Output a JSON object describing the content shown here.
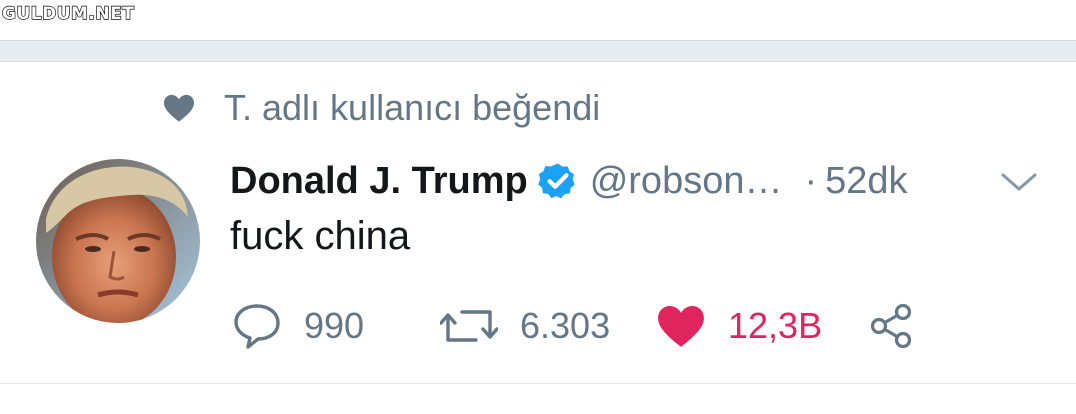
{
  "watermark": "GULDUM.NET",
  "social_context": {
    "text": "T. adlı kullanıcı beğendi",
    "icon": "heart-icon"
  },
  "tweet": {
    "display_name": "Donald J. Trump",
    "verified": true,
    "handle": "@robson…",
    "separator": "·",
    "time": "52dk",
    "text": "fuck china",
    "avatar_alt": "profile photo"
  },
  "actions": {
    "reply": {
      "icon": "reply-icon",
      "count": "990"
    },
    "retweet": {
      "icon": "retweet-icon",
      "count": "6.303"
    },
    "like": {
      "icon": "heart-filled-icon",
      "count": "12,3B",
      "active": true
    },
    "share": {
      "icon": "share-icon"
    }
  },
  "colors": {
    "secondary_text": "#657786",
    "primary_text": "#14171a",
    "verified_blue": "#1da1f2",
    "like_red": "#e0245e",
    "separator_bg": "#e6ecf0"
  }
}
